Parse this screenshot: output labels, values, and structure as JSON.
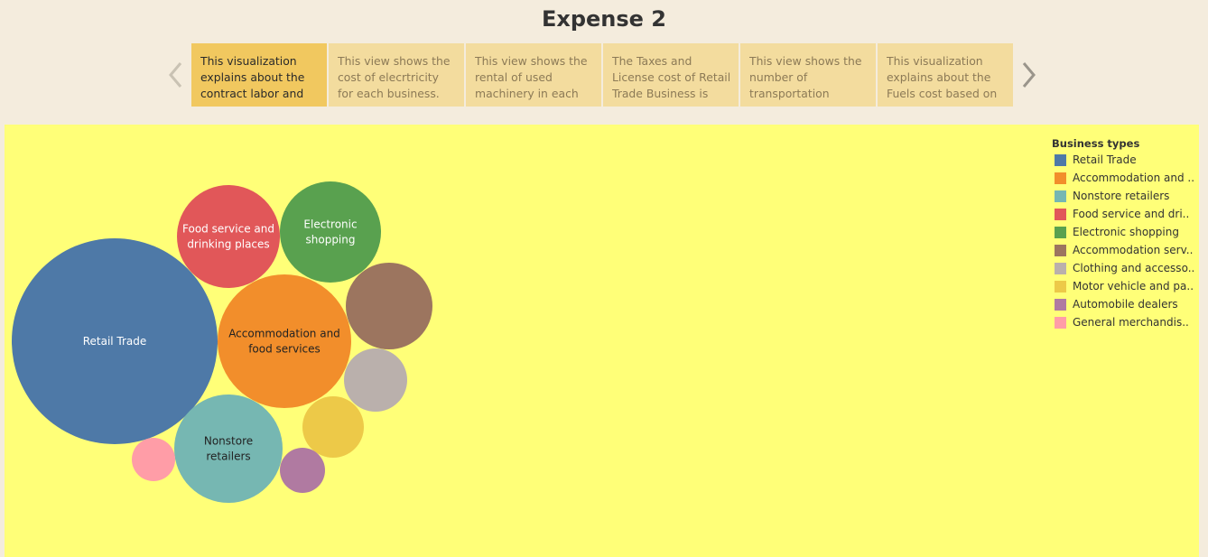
{
  "page": {
    "title": "Expense 2"
  },
  "story": {
    "points": [
      {
        "text": "This visualization explains about the contract labor and",
        "active": true
      },
      {
        "text": "This view shows the cost of elecrtricity for each business.",
        "active": false
      },
      {
        "text": "This view shows the rental of used machinery in each",
        "active": false
      },
      {
        "text": "The Taxes and License cost of Retail Trade Business is more than",
        "active": false
      },
      {
        "text": "This view shows the number of transportation",
        "active": false
      },
      {
        "text": "This visualization explains about the Fuels cost based on",
        "active": false
      }
    ],
    "prev_icon": "chevron-left-icon",
    "next_icon": "chevron-right-icon"
  },
  "legend": {
    "title": "Business types",
    "items": [
      {
        "label": "Retail Trade",
        "color": "#4e79a7"
      },
      {
        "label": "Accommodation and ..",
        "color": "#f28e2b"
      },
      {
        "label": "Nonstore retailers",
        "color": "#76b7b2"
      },
      {
        "label": "Food service and dri..",
        "color": "#e15759"
      },
      {
        "label": "Electronic shopping",
        "color": "#59a14f"
      },
      {
        "label": "Accommodation serv..",
        "color": "#9c755f"
      },
      {
        "label": "Clothing and accesso..",
        "color": "#bab0ac"
      },
      {
        "label": "Motor vehicle and pa..",
        "color": "#edc948"
      },
      {
        "label": "Automobile dealers",
        "color": "#b07aa1"
      },
      {
        "label": "General merchandis..",
        "color": "#ff9da7"
      }
    ]
  },
  "chart_data": {
    "type": "bubble",
    "background": "#ffff78",
    "bubbles": [
      {
        "name": "Retail Trade",
        "label": [
          "Retail Trade"
        ],
        "color": "#4e79a7",
        "label_color": "#ffffff"
      },
      {
        "name": "Accommodation and food services",
        "label": [
          "Accommodation and",
          "food services"
        ],
        "color": "#f28e2b",
        "label_color": "#222222"
      },
      {
        "name": "Nonstore retailers",
        "label": [
          "Nonstore",
          "retailers"
        ],
        "color": "#76b7b2",
        "label_color": "#222222"
      },
      {
        "name": "Food service and drinking places",
        "label": [
          "Food service and",
          "drinking places"
        ],
        "color": "#e15759",
        "label_color": "#ffffff"
      },
      {
        "name": "Electronic shopping",
        "label": [
          "Electronic",
          "shopping"
        ],
        "color": "#59a14f",
        "label_color": "#ffffff"
      },
      {
        "name": "Accommodation services",
        "label": [],
        "color": "#9c755f",
        "label_color": "#ffffff"
      },
      {
        "name": "Clothing and accessories",
        "label": [],
        "color": "#bab0ac",
        "label_color": "#ffffff"
      },
      {
        "name": "Motor vehicle and parts",
        "label": [],
        "color": "#edc948",
        "label_color": "#ffffff"
      },
      {
        "name": "Automobile dealers",
        "label": [],
        "color": "#b07aa1",
        "label_color": "#ffffff"
      },
      {
        "name": "General merchandise",
        "label": [],
        "color": "#ff9da7",
        "label_color": "#ffffff"
      }
    ]
  }
}
